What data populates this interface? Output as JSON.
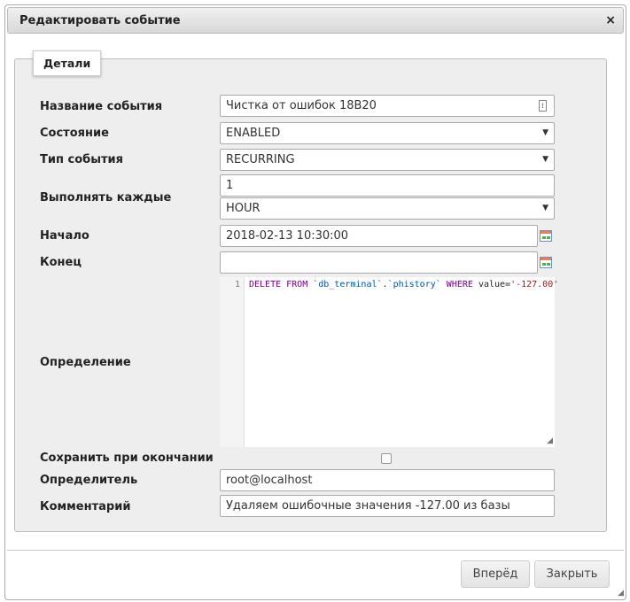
{
  "dialog": {
    "title": "Редактировать событие",
    "close_icon": "×"
  },
  "tab": "Детали",
  "fields": {
    "name": {
      "label": "Название события",
      "value": "Чистка от ошибок 18B20"
    },
    "state": {
      "label": "Состояние",
      "value": "ENABLED"
    },
    "type": {
      "label": "Тип события",
      "value": "RECURRING"
    },
    "every": {
      "label": "Выполнять каждые",
      "value": "1",
      "unit": "HOUR"
    },
    "start": {
      "label": "Начало",
      "value": "2018-02-13 10:30:00"
    },
    "end": {
      "label": "Конец",
      "value": ""
    },
    "definition": {
      "label": "Определение",
      "line_no": "1",
      "kw1": "DELETE FROM ",
      "t1": "`db_terminal`",
      "dot": ".",
      "t2": "`phistory`",
      "kw2": " WHERE ",
      "col": "value=",
      "str": "'-127.00'"
    },
    "preserve": {
      "label": "Сохранить при окончании",
      "checked": false
    },
    "definer": {
      "label": "Определитель",
      "value": "root@localhost"
    },
    "comment": {
      "label": "Комментарий",
      "value": "Удаляем ошибочные значения -127.00 из базы"
    }
  },
  "buttons": {
    "go": "Вперёд",
    "close": "Закрыть"
  }
}
